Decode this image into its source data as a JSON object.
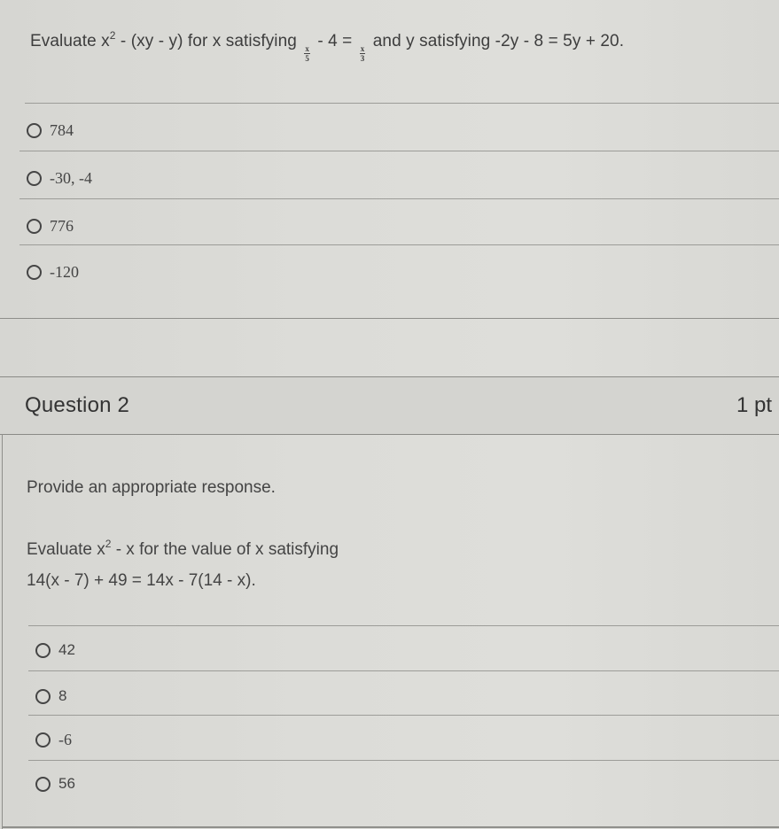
{
  "question1": {
    "stem": {
      "evaluate": "Evaluate ",
      "x": "x",
      "exp": "2",
      "mid1": " - (xy - y) for x satisfying ",
      "frac1_num": "x",
      "frac1_den": "5",
      "mid2": " - 4 = ",
      "frac2_num": "x",
      "frac2_den": "3",
      "tail": " and y satisfying -2y - 8 = 5y + 20."
    },
    "options": [
      {
        "label": "784",
        "selected": false
      },
      {
        "label": "-30, -4",
        "selected": false
      },
      {
        "label": "776",
        "selected": false
      },
      {
        "label": "-120",
        "selected": false
      }
    ]
  },
  "question2": {
    "title": "Question 2",
    "points": "1 pt",
    "prompt": "Provide an appropriate response.",
    "stem": {
      "evaluate": "Evaluate ",
      "x": "x",
      "exp": "2",
      "tail": " - x for the value of x satisfying",
      "line2": "14(x - 7) + 49 = 14x - 7(14 - x)."
    },
    "options": [
      {
        "label": "42",
        "selected": false
      },
      {
        "label": "8",
        "selected": false
      },
      {
        "label": "-6",
        "selected": false
      },
      {
        "label": "56",
        "selected": false
      }
    ]
  }
}
